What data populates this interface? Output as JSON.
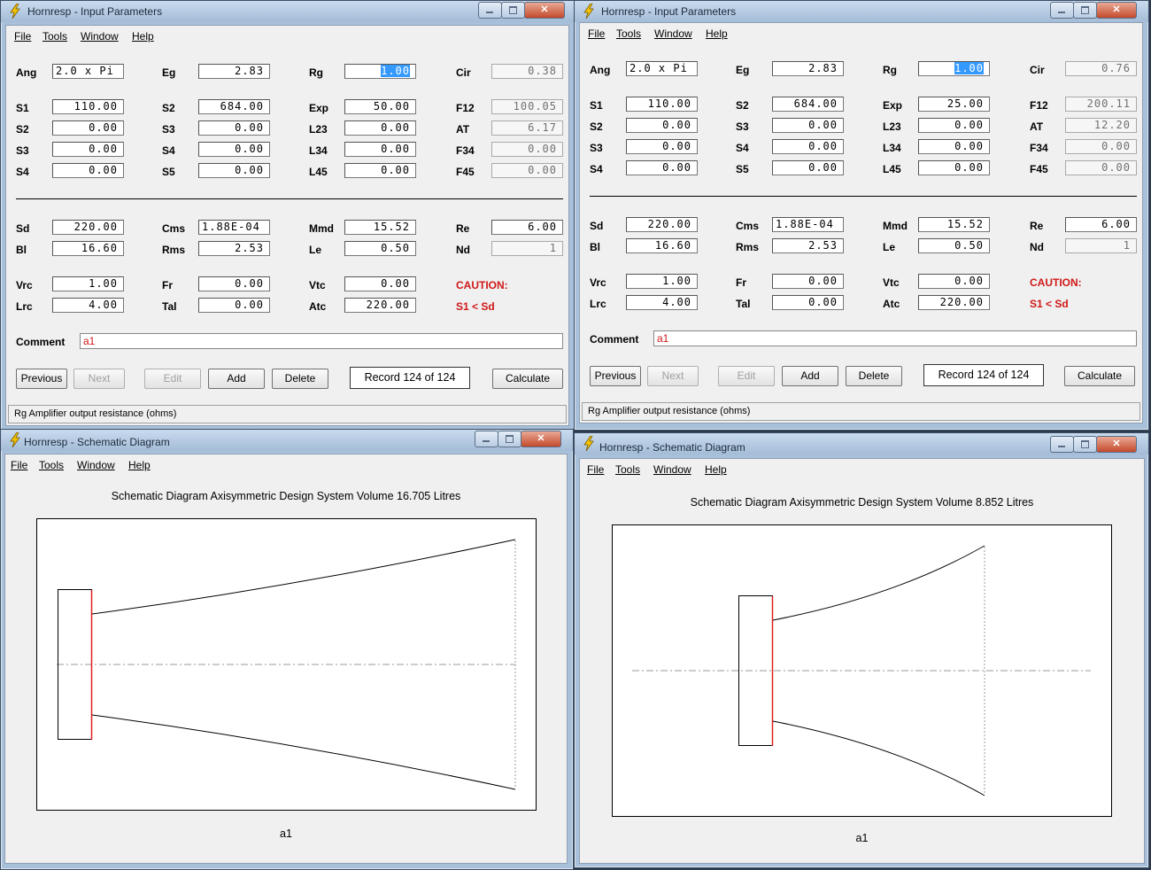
{
  "menu": {
    "file": "File",
    "tools": "Tools",
    "window": "Window",
    "help": "Help"
  },
  "input_windows": [
    {
      "title": "Hornresp - Input Parameters",
      "fields": {
        "Ang": {
          "label": "Ang",
          "value": "2.0 x Pi"
        },
        "Eg": {
          "label": "Eg",
          "value": "2.83"
        },
        "Rg": {
          "label": "Rg",
          "value": "1.00"
        },
        "Cir": {
          "label": "Cir",
          "value": "0.38"
        },
        "S1": {
          "label": "S1",
          "value": "110.00"
        },
        "S2a": {
          "label": "S2",
          "value": "684.00"
        },
        "Exp": {
          "label": "Exp",
          "value": "50.00"
        },
        "F12": {
          "label": "F12",
          "value": "100.05"
        },
        "S2": {
          "label": "S2",
          "value": "0.00"
        },
        "S3a": {
          "label": "S3",
          "value": "0.00"
        },
        "L23": {
          "label": "L23",
          "value": "0.00"
        },
        "AT": {
          "label": "AT",
          "value": "6.17"
        },
        "S3": {
          "label": "S3",
          "value": "0.00"
        },
        "S4a": {
          "label": "S4",
          "value": "0.00"
        },
        "L34": {
          "label": "L34",
          "value": "0.00"
        },
        "F34": {
          "label": "F34",
          "value": "0.00"
        },
        "S4": {
          "label": "S4",
          "value": "0.00"
        },
        "S5": {
          "label": "S5",
          "value": "0.00"
        },
        "L45": {
          "label": "L45",
          "value": "0.00"
        },
        "F45": {
          "label": "F45",
          "value": "0.00"
        },
        "Sd": {
          "label": "Sd",
          "value": "220.00"
        },
        "Cms": {
          "label": "Cms",
          "value": "1.88E-04"
        },
        "Mmd": {
          "label": "Mmd",
          "value": "15.52"
        },
        "Re": {
          "label": "Re",
          "value": "6.00"
        },
        "Bl": {
          "label": "Bl",
          "value": "16.60"
        },
        "Rms": {
          "label": "Rms",
          "value": "2.53"
        },
        "Le": {
          "label": "Le",
          "value": "0.50"
        },
        "Nd": {
          "label": "Nd",
          "value": "1"
        },
        "Vrc": {
          "label": "Vrc",
          "value": "1.00"
        },
        "Fr": {
          "label": "Fr",
          "value": "0.00"
        },
        "Vtc": {
          "label": "Vtc",
          "value": "0.00"
        },
        "Lrc": {
          "label": "Lrc",
          "value": "4.00"
        },
        "Tal": {
          "label": "Tal",
          "value": "0.00"
        },
        "Atc": {
          "label": "Atc",
          "value": "220.00"
        }
      },
      "caution_title": "CAUTION:",
      "caution_text": "S1 < Sd",
      "comment_label": "Comment",
      "comment_value": "a1",
      "buttons": {
        "previous": "Previous",
        "next": "Next",
        "edit": "Edit",
        "add": "Add",
        "delete": "Delete",
        "calculate": "Calculate"
      },
      "record": "Record 124 of 124",
      "status": "Rg   Amplifier output resistance  (ohms)"
    },
    {
      "title": "Hornresp - Input Parameters",
      "fields": {
        "Ang": {
          "label": "Ang",
          "value": "2.0 x Pi"
        },
        "Eg": {
          "label": "Eg",
          "value": "2.83"
        },
        "Rg": {
          "label": "Rg",
          "value": "1.00"
        },
        "Cir": {
          "label": "Cir",
          "value": "0.76"
        },
        "S1": {
          "label": "S1",
          "value": "110.00"
        },
        "S2a": {
          "label": "S2",
          "value": "684.00"
        },
        "Exp": {
          "label": "Exp",
          "value": "25.00"
        },
        "F12": {
          "label": "F12",
          "value": "200.11"
        },
        "S2": {
          "label": "S2",
          "value": "0.00"
        },
        "S3a": {
          "label": "S3",
          "value": "0.00"
        },
        "L23": {
          "label": "L23",
          "value": "0.00"
        },
        "AT": {
          "label": "AT",
          "value": "12.20"
        },
        "S3": {
          "label": "S3",
          "value": "0.00"
        },
        "S4a": {
          "label": "S4",
          "value": "0.00"
        },
        "L34": {
          "label": "L34",
          "value": "0.00"
        },
        "F34": {
          "label": "F34",
          "value": "0.00"
        },
        "S4": {
          "label": "S4",
          "value": "0.00"
        },
        "S5": {
          "label": "S5",
          "value": "0.00"
        },
        "L45": {
          "label": "L45",
          "value": "0.00"
        },
        "F45": {
          "label": "F45",
          "value": "0.00"
        },
        "Sd": {
          "label": "Sd",
          "value": "220.00"
        },
        "Cms": {
          "label": "Cms",
          "value": "1.88E-04"
        },
        "Mmd": {
          "label": "Mmd",
          "value": "15.52"
        },
        "Re": {
          "label": "Re",
          "value": "6.00"
        },
        "Bl": {
          "label": "Bl",
          "value": "16.60"
        },
        "Rms": {
          "label": "Rms",
          "value": "2.53"
        },
        "Le": {
          "label": "Le",
          "value": "0.50"
        },
        "Nd": {
          "label": "Nd",
          "value": "1"
        },
        "Vrc": {
          "label": "Vrc",
          "value": "1.00"
        },
        "Fr": {
          "label": "Fr",
          "value": "0.00"
        },
        "Vtc": {
          "label": "Vtc",
          "value": "0.00"
        },
        "Lrc": {
          "label": "Lrc",
          "value": "4.00"
        },
        "Tal": {
          "label": "Tal",
          "value": "0.00"
        },
        "Atc": {
          "label": "Atc",
          "value": "220.00"
        }
      },
      "caution_title": "CAUTION:",
      "caution_text": "S1 < Sd",
      "comment_label": "Comment",
      "comment_value": "a1",
      "buttons": {
        "previous": "Previous",
        "next": "Next",
        "edit": "Edit",
        "add": "Add",
        "delete": "Delete",
        "calculate": "Calculate"
      },
      "record": "Record 124 of 124",
      "status": "Rg   Amplifier output resistance  (ohms)"
    }
  ],
  "schematic_windows": [
    {
      "title": "Hornresp - Schematic Diagram",
      "heading": "Schematic Diagram    Axisymmetric Design    System Volume 16.705 Litres",
      "caption": "a1"
    },
    {
      "title": "Hornresp - Schematic Diagram",
      "heading": "Schematic Diagram    Axisymmetric Design    System Volume 8.852 Litres",
      "caption": "a1"
    }
  ],
  "colors": {
    "driver_face": "#e02020",
    "caution": "#d01818",
    "selection": "#3399ff"
  }
}
